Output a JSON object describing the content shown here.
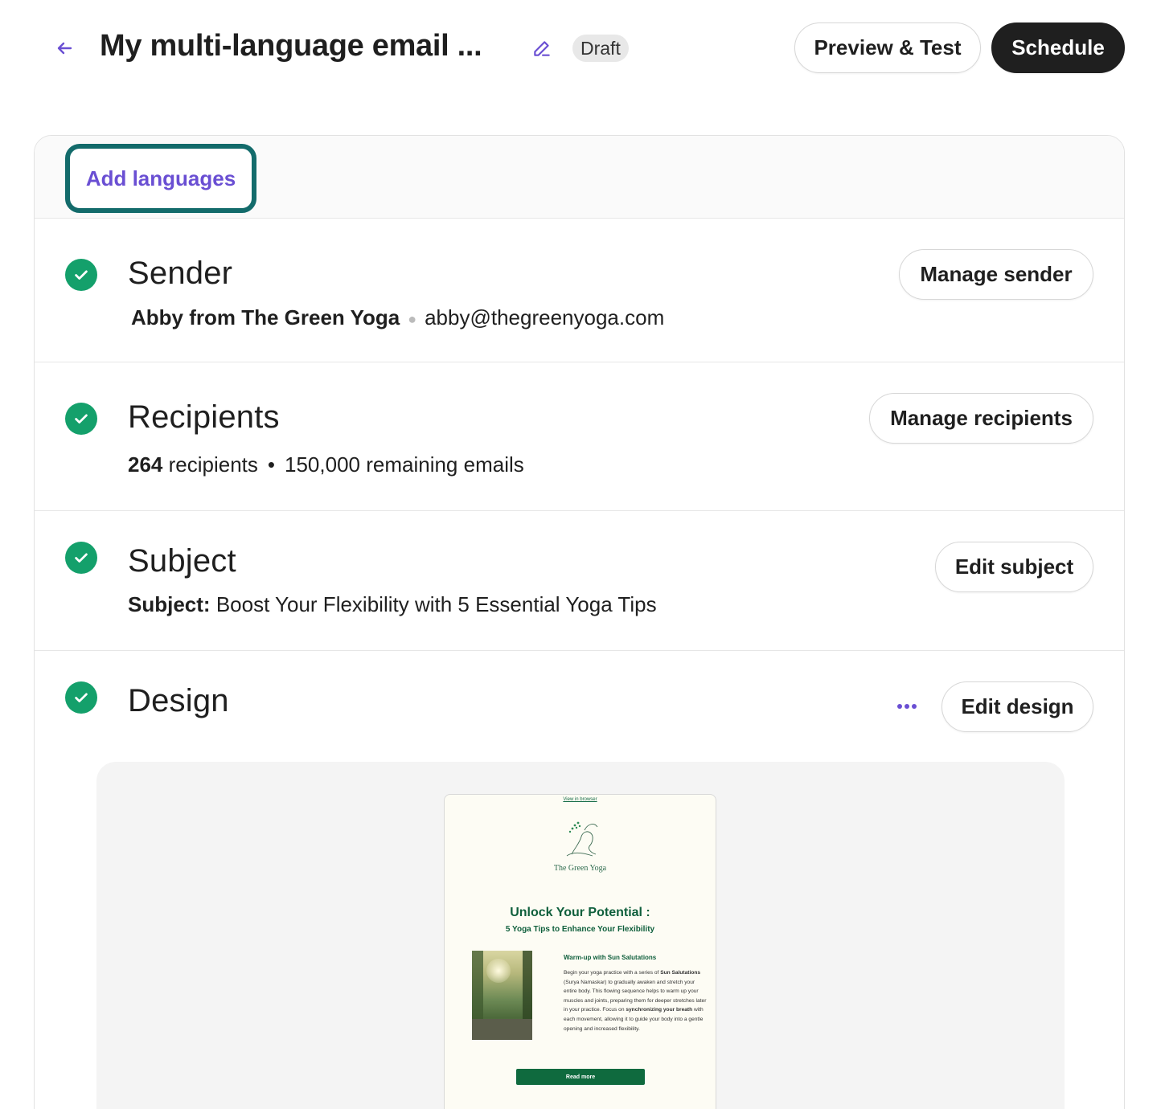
{
  "header": {
    "title": "My multi-language email ...",
    "status": "Draft",
    "preview_label": "Preview & Test",
    "schedule_label": "Schedule"
  },
  "languages": {
    "add_label": "Add languages"
  },
  "sender": {
    "title": "Sender",
    "name": "Abby from The Green Yoga",
    "email": "abby@thegreenyoga.com",
    "button": "Manage sender"
  },
  "recipients": {
    "title": "Recipients",
    "count": "264",
    "count_suffix": "recipients",
    "remaining": "150,000 remaining emails",
    "button": "Manage recipients"
  },
  "subject": {
    "title": "Subject",
    "label": "Subject:",
    "value": "Boost Your Flexibility with 5 Essential Yoga Tips",
    "button": "Edit subject"
  },
  "design": {
    "title": "Design",
    "button": "Edit design",
    "email_preview": {
      "view_in_browser": "View in browser",
      "brand": "The Green Yoga",
      "headline": "Unlock Your Potential :",
      "subheadline": "5 Yoga Tips to Enhance Your Flexibility",
      "section_title": "Warm-up with Sun Salutations",
      "para_1": "Begin your yoga practice with a series of ",
      "para_bold_1": "Sun Salutations",
      "para_2": " (Surya Namaskar) to gradually awaken and stretch your entire body. This flowing sequence helps to warm up your muscles and joints, preparing them for deeper stretches later in your practice. Focus on ",
      "para_bold_2": "synchronizing your breath",
      "para_3": " with each movement, allowing it to guide your body into a gentle opening and increased flexibility.",
      "cta": "Read more"
    }
  },
  "colors": {
    "accent_purple": "#6a4fd3",
    "success_green": "#14a06b",
    "focus_teal": "#136b6b",
    "dark_button": "#1f1f1f",
    "email_green": "#0f5f3c"
  },
  "icons": {
    "back": "arrow-left-icon",
    "edit_title": "pencil-icon",
    "check": "check-circle-icon",
    "more": "more-horizontal-icon"
  }
}
